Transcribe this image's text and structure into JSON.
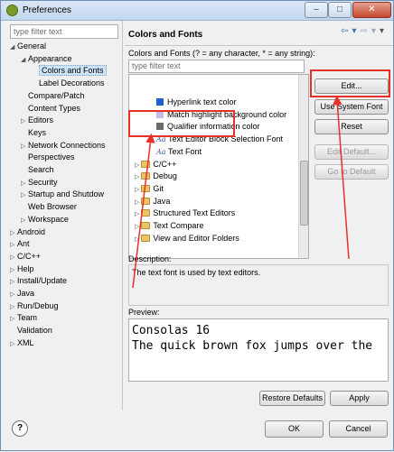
{
  "window": {
    "title": "Preferences"
  },
  "left": {
    "filter_placeholder": "type filter text",
    "tree": [
      {
        "label": "General",
        "expanded": true
      },
      {
        "label": "Appearance",
        "expanded": true
      },
      {
        "label": "Colors and Fonts",
        "selected": true
      },
      {
        "label": "Label Decorations"
      },
      {
        "label": "Compare/Patch"
      },
      {
        "label": "Content Types"
      },
      {
        "label": "Editors",
        "expandable": true
      },
      {
        "label": "Keys"
      },
      {
        "label": "Network Connections",
        "expandable": true
      },
      {
        "label": "Perspectives"
      },
      {
        "label": "Search"
      },
      {
        "label": "Security",
        "expandable": true
      },
      {
        "label": "Startup and Shutdow",
        "expandable": true
      },
      {
        "label": "Web Browser"
      },
      {
        "label": "Workspace",
        "expandable": true
      },
      {
        "label": "Android",
        "expandable": true
      },
      {
        "label": "Ant",
        "expandable": true
      },
      {
        "label": "C/C++",
        "expandable": true
      },
      {
        "label": "Help",
        "expandable": true
      },
      {
        "label": "Install/Update",
        "expandable": true
      },
      {
        "label": "Java",
        "expandable": true
      },
      {
        "label": "Run/Debug",
        "expandable": true
      },
      {
        "label": "Team",
        "expandable": true
      },
      {
        "label": "Validation"
      },
      {
        "label": "XML",
        "expandable": true
      }
    ]
  },
  "right": {
    "title": "Colors and Fonts",
    "description": "Colors and Fonts (? = any character, * = any string):",
    "filter_placeholder": "type filter text",
    "list": [
      {
        "label": "Hyperlink text color",
        "kind": "color",
        "color": "#1f5fd0"
      },
      {
        "label": "Match highlight background color",
        "kind": "color",
        "color": "#c9b8e8"
      },
      {
        "label": "Qualifier information color",
        "kind": "color",
        "color": "#6b6b6b"
      },
      {
        "label": "Text Editor Block Selection Font",
        "kind": "font"
      },
      {
        "label": "Text Font",
        "kind": "font"
      },
      {
        "label": "C/C++",
        "kind": "folder"
      },
      {
        "label": "Debug",
        "kind": "folder"
      },
      {
        "label": "Git",
        "kind": "folder"
      },
      {
        "label": "Java",
        "kind": "folder"
      },
      {
        "label": "Structured Text Editors",
        "kind": "folder"
      },
      {
        "label": "Text Compare",
        "kind": "folder"
      },
      {
        "label": "View and Editor Folders",
        "kind": "folder"
      }
    ],
    "buttons": {
      "edit": "Edit...",
      "use_system_font": "Use System Font",
      "reset": "Reset",
      "edit_default": "Edit Default...",
      "goto_default": "Go to Default"
    },
    "description_label": "Description:",
    "description_text": "The text font is used by text editors.",
    "preview_label": "Preview:",
    "preview_lines": [
      "Consolas 16",
      "The quick brown fox jumps over the"
    ],
    "restore_defaults": "Restore Defaults",
    "apply": "Apply"
  },
  "bottom": {
    "help": "?",
    "ok": "OK",
    "cancel": "Cancel"
  },
  "colors": {
    "annotation": "#e8302a",
    "selection": "#cce4f7"
  }
}
